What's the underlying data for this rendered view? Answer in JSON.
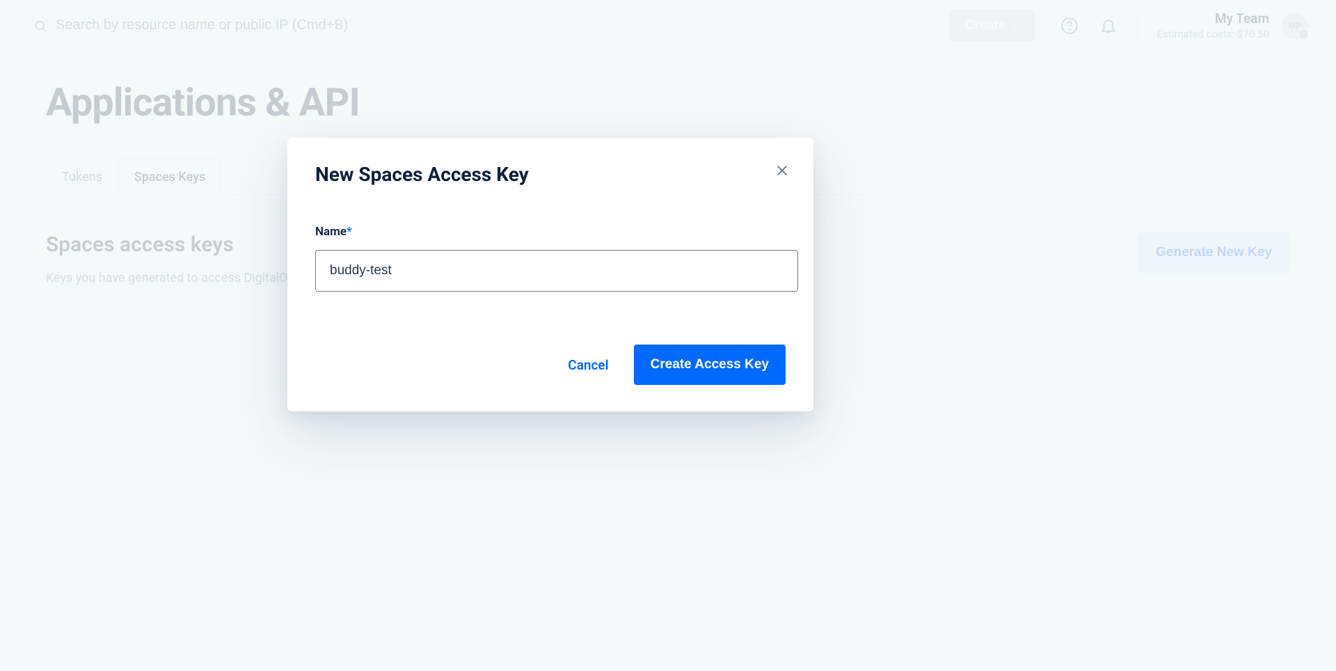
{
  "header": {
    "search_placeholder": "Search by resource name or public IP (Cmd+B)",
    "create_label": "Create",
    "team_name": "My Team",
    "cost_label": "Estimated costs: $76.50",
    "avatar_initials": "MP"
  },
  "page": {
    "title": "Applications & API",
    "tabs": [
      "Tokens",
      "Spaces Keys"
    ],
    "active_tab_index": 1,
    "section_title": "Spaces access keys",
    "section_sub": "Keys you have generated to access DigitalOcean Spaces",
    "generate_label": "Generate New Key"
  },
  "modal": {
    "title": "New Spaces Access Key",
    "name_label": "Name",
    "required_mark": "*",
    "name_value": "buddy-test",
    "cancel_label": "Cancel",
    "submit_label": "Create Access Key"
  }
}
